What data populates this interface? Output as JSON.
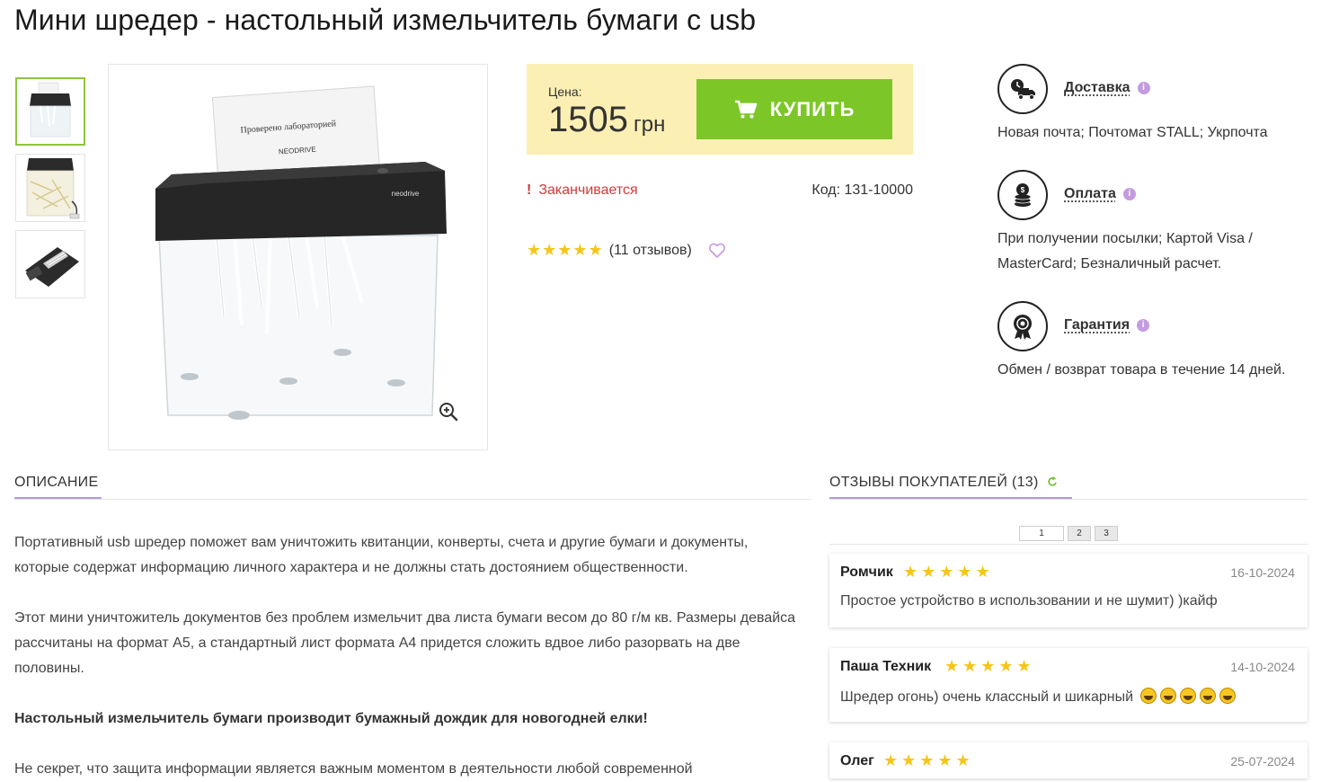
{
  "product": {
    "title": "Мини шредер - настольный измельчитель бумаги с usb",
    "image_paper_text": "Проверено лабораторией",
    "image_paper_brand": "NEODRIVE",
    "image_device_brand": "neodrive"
  },
  "price": {
    "label": "Цена:",
    "value": "1505",
    "currency": "грн",
    "buy_label": "КУПИТЬ"
  },
  "stock": {
    "mark": "!",
    "text": "Заканчивается"
  },
  "code": "Код: 131-10000",
  "rating": {
    "stars": "★★★★★",
    "count_text": "(11 отзывов)",
    "value": 5
  },
  "info": {
    "delivery": {
      "title": "Доставка",
      "text": "Новая почта; Почтомат STALL; Укрпочта",
      "icon": "truck-icon"
    },
    "payment": {
      "title": "Оплата",
      "text": "При получении посылки; Картой Visa / MasterCard; Безналичный расчет.",
      "icon": "coins-icon"
    },
    "warranty": {
      "title": "Гарантия",
      "text": "Обмен / возврат товара в течение 14 дней.",
      "icon": "badge-icon"
    }
  },
  "description": {
    "title": "ОПИСАНИЕ",
    "p1": "Портативный usb шредер поможет вам уничтожить квитанции, конверты, счета и другие бумаги и документы, которые содержат информацию личного характера и не должны стать достоянием общественности.",
    "p2": "Этот мини уничтожитель документов без проблем измельчит два листа бумаги весом до 80 г/м кв. Размеры девайса рассчитаны на формат А5, а стандартный лист формата А4 придется сложить вдвое либо разорвать на две половины.",
    "p3": "Настольный измельчитель бумаги производит бумажный дождик для новогодней елки!",
    "p4": "Не секрет, что защита информации является важным моментом в деятельности любой современной"
  },
  "reviews": {
    "title": "ОТЗЫВЫ ПОКУПАТЕЛЕЙ (13)",
    "pages": [
      "1",
      "2",
      "3"
    ],
    "items": [
      {
        "name": "Ромчик",
        "stars": "★★★★★",
        "date": "16-10-2024",
        "text": "Простое устройство в использовании и не шумит) )кайф"
      },
      {
        "name": "Паша Техник",
        "stars": "★★★★★",
        "date": "14-10-2024",
        "text": "Шредер огонь) очень классный и шикарный"
      },
      {
        "name": "Олег",
        "stars": "★★★★★",
        "date": "25-07-2024",
        "text": ""
      }
    ]
  }
}
